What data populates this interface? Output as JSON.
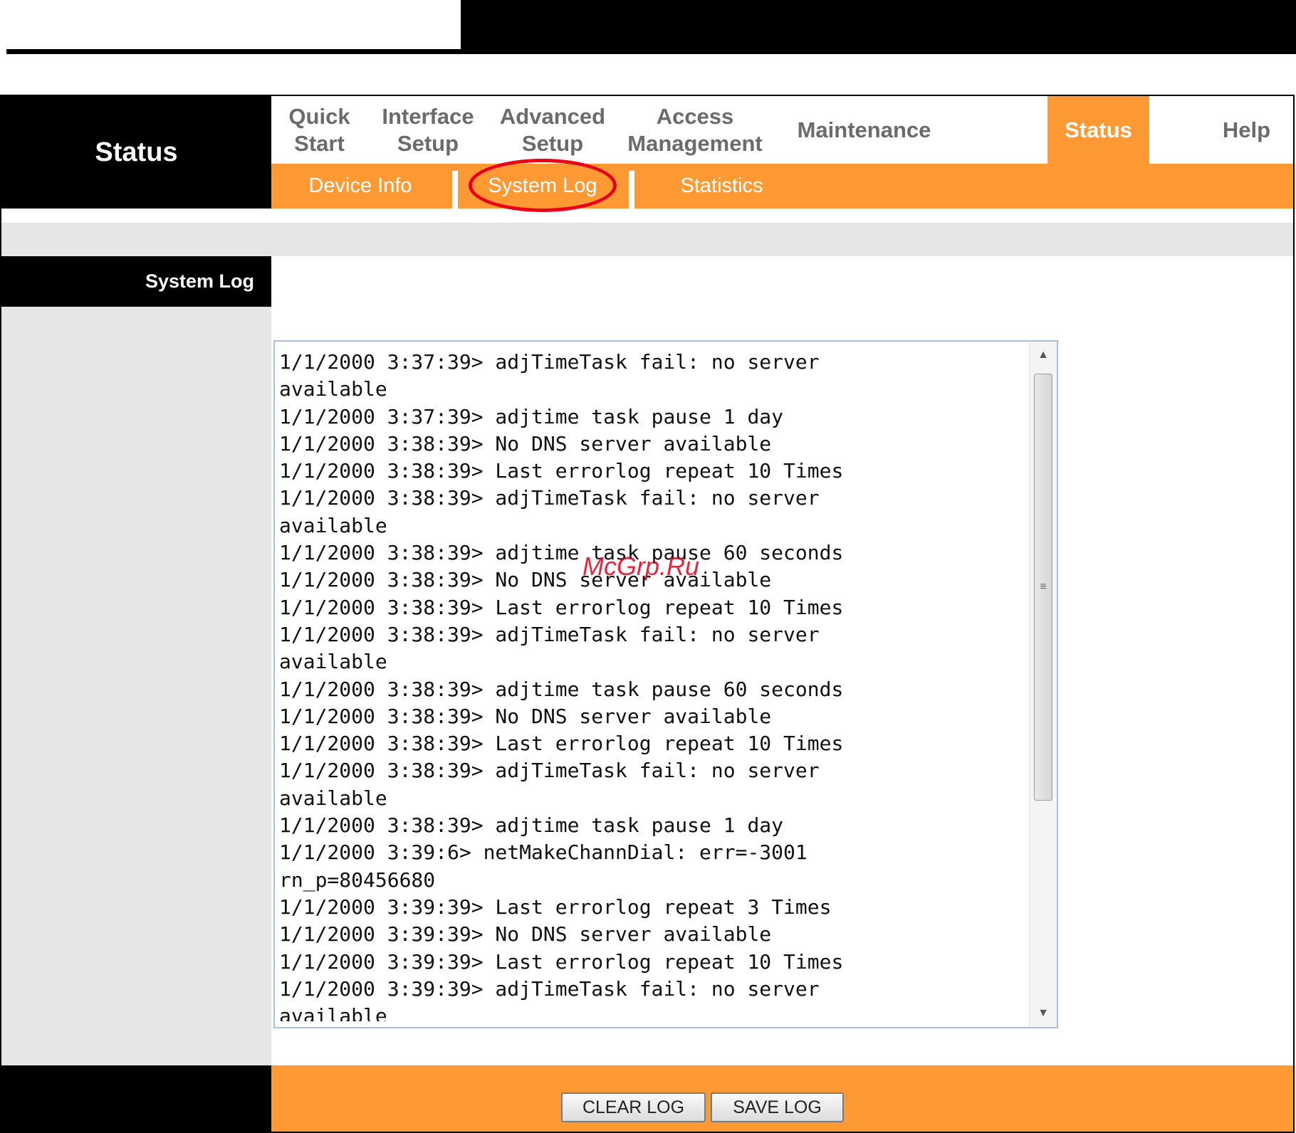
{
  "brand": {
    "title": "Status"
  },
  "main_nav": [
    {
      "label": "Quick\nStart",
      "active": false
    },
    {
      "label": "Interface\nSetup",
      "active": false
    },
    {
      "label": "Advanced\nSetup",
      "active": false
    },
    {
      "label": "Access\nManagement",
      "active": false
    },
    {
      "label": "Maintenance",
      "active": false
    },
    {
      "label": "Status",
      "active": true
    },
    {
      "label": "Help",
      "active": false
    }
  ],
  "sub_nav": [
    {
      "label": "Device Info"
    },
    {
      "label": "System Log",
      "highlighted": true
    },
    {
      "label": "Statistics"
    }
  ],
  "sidebar": {
    "title": "System Log"
  },
  "log": {
    "lines": [
      "1/1/2000 3:37:39> adjTimeTask fail: no server",
      "available",
      "1/1/2000 3:37:39> adjtime task pause 1 day",
      "1/1/2000 3:38:39> No DNS server available",
      "1/1/2000 3:38:39> Last errorlog repeat 10 Times",
      "1/1/2000 3:38:39> adjTimeTask fail: no server",
      "available",
      "1/1/2000 3:38:39> adjtime task pause 60 seconds",
      "1/1/2000 3:38:39> No DNS server available",
      "1/1/2000 3:38:39> Last errorlog repeat 10 Times",
      "1/1/2000 3:38:39> adjTimeTask fail: no server",
      "available",
      "1/1/2000 3:38:39> adjtime task pause 60 seconds",
      "1/1/2000 3:38:39> No DNS server available",
      "1/1/2000 3:38:39> Last errorlog repeat 10 Times",
      "1/1/2000 3:38:39> adjTimeTask fail: no server",
      "available",
      "1/1/2000 3:38:39> adjtime task pause 1 day",
      "1/1/2000 3:39:6> netMakeChannDial: err=-3001",
      "rn_p=80456680",
      "1/1/2000 3:39:39> Last errorlog repeat 3 Times",
      "1/1/2000 3:39:39> No DNS server available",
      "1/1/2000 3:39:39> Last errorlog repeat 10 Times",
      "1/1/2000 3:39:39> adjTimeTask fail: no server",
      "available"
    ]
  },
  "watermark": "McGrp.Ru",
  "buttons": {
    "clear": "CLEAR LOG",
    "save": "SAVE LOG"
  },
  "colors": {
    "accent": "#ff9933",
    "highlight_ring": "#e8001a",
    "band": "#e6e6e6"
  },
  "icons": {
    "scroll_up": "triangle-up-icon",
    "scroll_down": "triangle-down-icon",
    "grip": "grip-icon"
  }
}
